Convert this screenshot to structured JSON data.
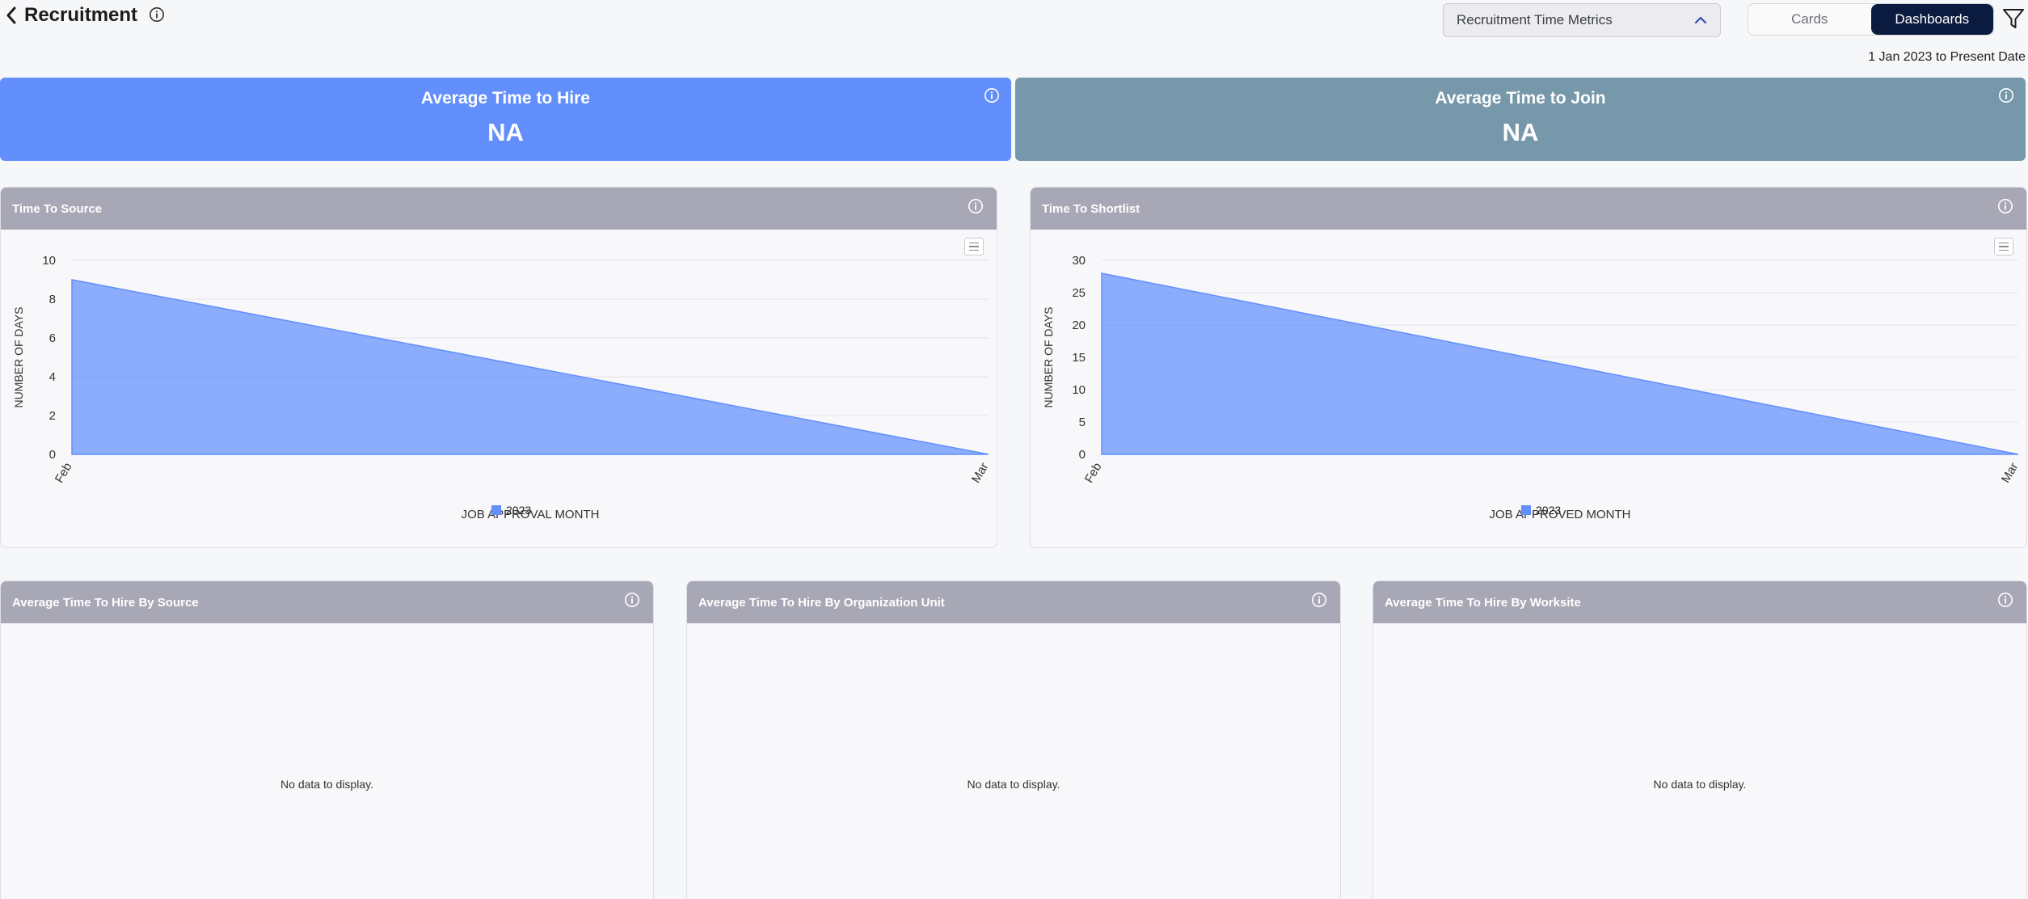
{
  "header": {
    "title": "Recruitment",
    "metric_select": "Recruitment Time Metrics",
    "toggle": {
      "cards": "Cards",
      "dashboards": "Dashboards",
      "active": "dashboards"
    },
    "date_range": "1 Jan 2023 to Present Date"
  },
  "kpis": [
    {
      "title": "Average Time to Hire",
      "value": "NA",
      "color": "#638ffc"
    },
    {
      "title": "Average Time to Join",
      "value": "NA",
      "color": "#7798aa"
    }
  ],
  "panels": {
    "time_to_source": {
      "title": "Time To Source"
    },
    "time_to_shortlist": {
      "title": "Time To Shortlist"
    },
    "by_source": {
      "title": "Average Time To Hire By Source",
      "empty": "No data to display."
    },
    "by_org_unit": {
      "title": "Average Time To Hire By Organization Unit",
      "empty": "No data to display."
    },
    "by_worksite": {
      "title": "Average Time To Hire By Worksite",
      "empty": "No data to display."
    }
  },
  "chart_data": [
    {
      "type": "area",
      "title": "Time To Source",
      "xlabel": "JOB APPROVAL MONTH",
      "ylabel": "NUMBER OF DAYS",
      "categories": [
        "Feb",
        "Mar"
      ],
      "ylim": [
        0,
        10
      ],
      "yticks": [
        "0",
        "2",
        "4",
        "6",
        "8",
        "10"
      ],
      "series": [
        {
          "name": "2023",
          "values": [
            9,
            0
          ],
          "color": "#638ffc"
        }
      ],
      "legend": "bottom-center",
      "grid": true
    },
    {
      "type": "area",
      "title": "Time To Shortlist",
      "xlabel": "JOB APPROVED MONTH",
      "ylabel": "NUMBER OF DAYS",
      "categories": [
        "Feb",
        "Mar"
      ],
      "ylim": [
        0,
        30
      ],
      "yticks": [
        "0",
        "5",
        "10",
        "15",
        "20",
        "25",
        "30"
      ],
      "series": [
        {
          "name": "2023",
          "values": [
            28,
            0
          ],
          "color": "#638ffc"
        }
      ],
      "legend": "bottom-center",
      "grid": true
    }
  ]
}
